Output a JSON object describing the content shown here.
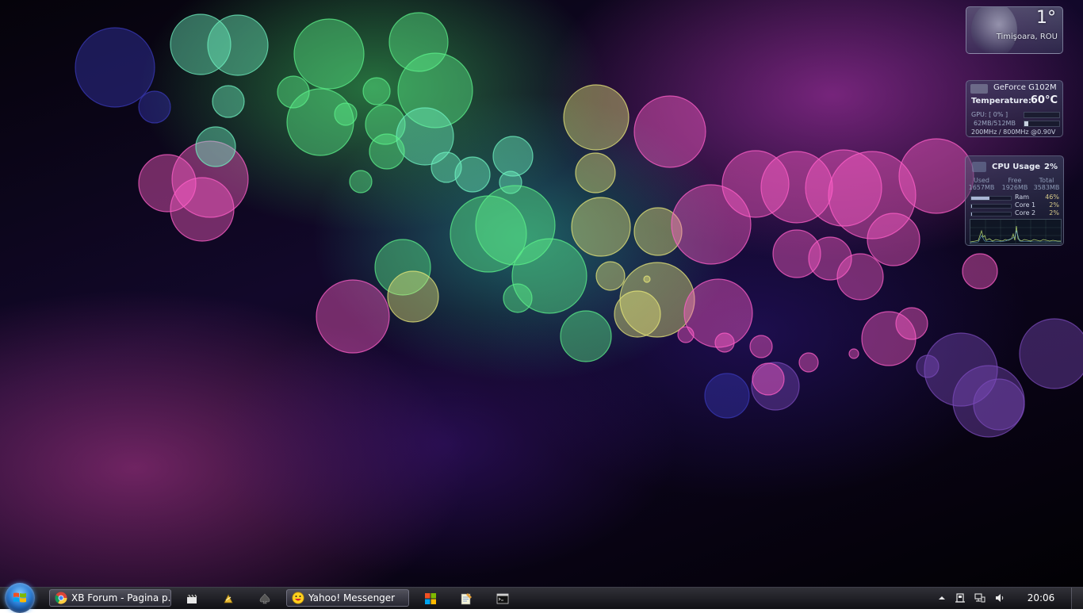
{
  "weather": {
    "temperature": "1°",
    "location": "Timişoara, ROU"
  },
  "gpu_gadget": {
    "name": "GeForce G102M",
    "temperature_label": "Temperature:",
    "temperature_value": "60°C",
    "gpu_load": "GPU: [ 0% ]",
    "memory": "62MB/512MB",
    "clocks": "200MHz / 800MHz @0.90V",
    "gpu_fraction": 0.0,
    "mem_fraction": 0.12
  },
  "cpu_gadget": {
    "title": "CPU Usage",
    "percent": "2%",
    "columns": [
      {
        "label": "Used",
        "value": "1657MB"
      },
      {
        "label": "Free",
        "value": "1926MB"
      },
      {
        "label": "Total",
        "value": "3583MB"
      }
    ],
    "rows": [
      {
        "label": "Ram",
        "value": "46%",
        "fraction": 0.46
      },
      {
        "label": "Core 1",
        "value": "2%",
        "fraction": 0.02
      },
      {
        "label": "Core 2",
        "value": "2%",
        "fraction": 0.02
      }
    ]
  },
  "taskbar": {
    "windows": [
      {
        "label": "XB Forum - Pagina p...",
        "icon": "chrome-icon"
      },
      {
        "label": "Yahoo! Messenger",
        "icon": "yahoo-messenger-icon"
      }
    ],
    "pinned": [
      {
        "icon": "clapperboard-icon"
      },
      {
        "icon": "winamp-icon"
      },
      {
        "icon": "spade-icon"
      },
      {
        "icon": "windows-flag-icon"
      },
      {
        "icon": "notepad-icon"
      },
      {
        "icon": "command-prompt-icon"
      }
    ],
    "tray": [
      {
        "icon": "show-hidden-icons-arrow"
      },
      {
        "icon": "device-icon"
      },
      {
        "icon": "network-icon"
      },
      {
        "icon": "volume-icon"
      }
    ],
    "clock": "20:06"
  },
  "colors": {
    "green_bokeh": "#5cf08a",
    "teal_bokeh": "#6ff2c0",
    "yellow_bokeh": "#e8e87a",
    "pink_bokeh": "#ff5fc8",
    "violet_bokeh": "#7a4ab8",
    "blue_bokeh": "#3a3ab8"
  }
}
